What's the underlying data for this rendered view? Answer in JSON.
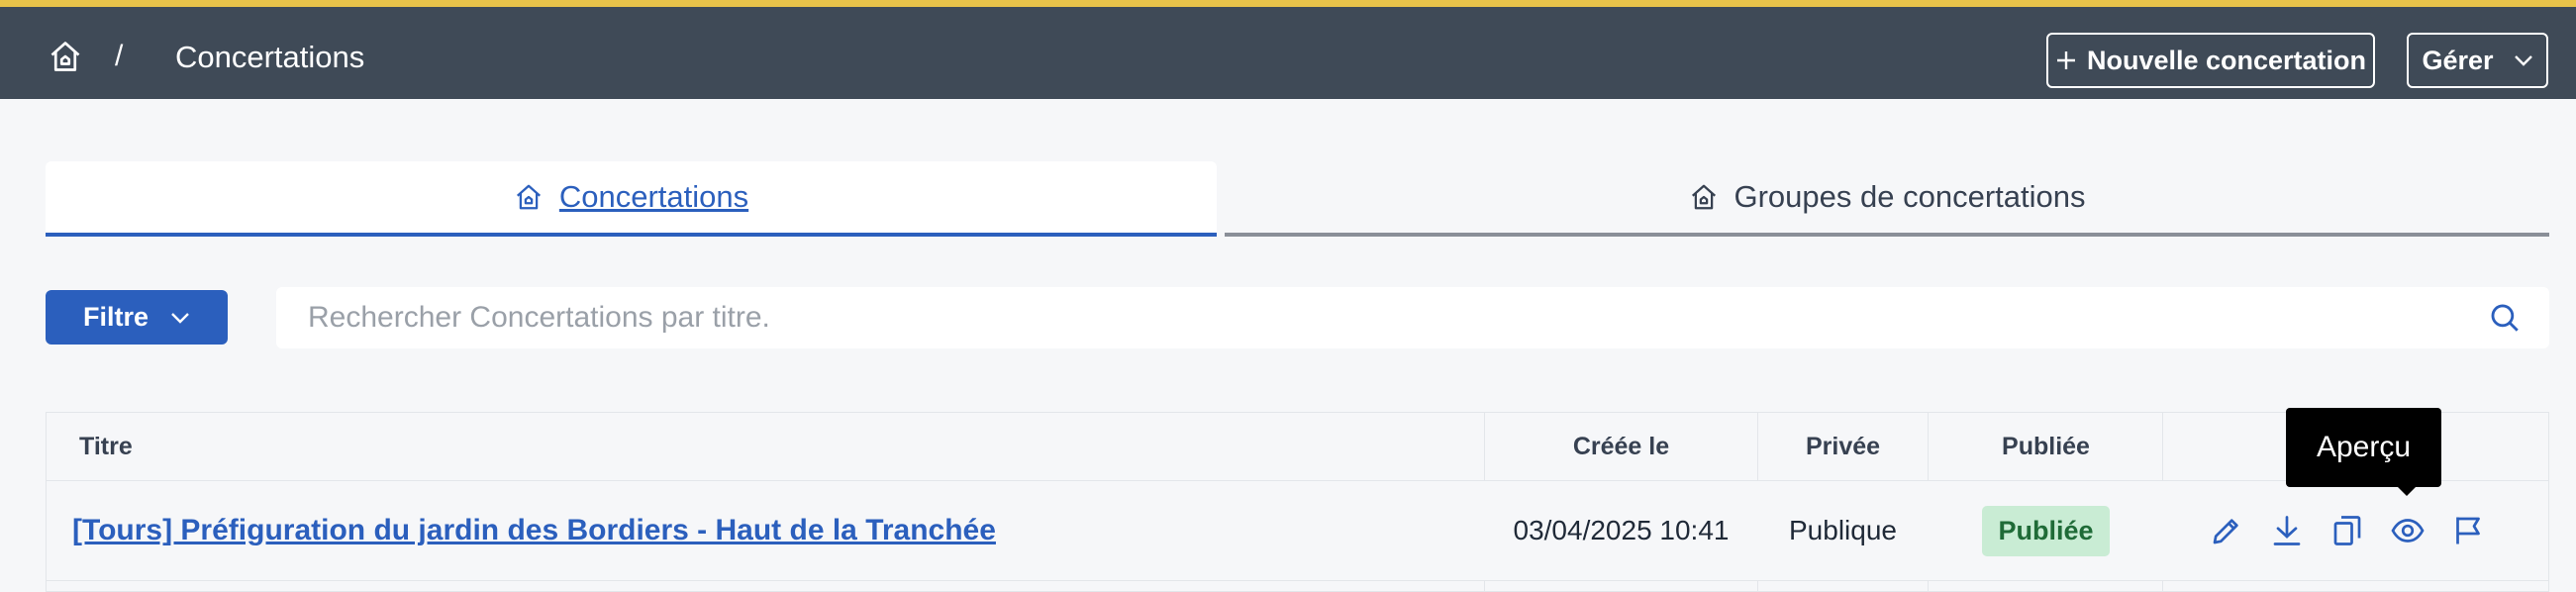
{
  "header": {
    "breadcrumb_separator": "/",
    "page_title": "Concertations",
    "new_button_label": "Nouvelle concertation",
    "manage_button_label": "Gérer",
    "accent_color": "#e8c34a",
    "bar_color": "#3f4a57"
  },
  "tabs": [
    {
      "label": "Concertations",
      "active": true
    },
    {
      "label": "Groupes de concertations",
      "active": false
    }
  ],
  "filter": {
    "label": "Filtre"
  },
  "search": {
    "placeholder": "Rechercher Concertations par titre."
  },
  "table": {
    "columns": [
      "Titre",
      "Créée le",
      "Privée",
      "Publiée"
    ],
    "rows": [
      {
        "title": "[Tours] Préfiguration du jardin des Bordiers - Haut de la Tranchée",
        "created": "03/04/2025 10:41",
        "privacy": "Publique",
        "status": "Publiée",
        "actions": [
          "edit-icon",
          "download-icon",
          "copy-icon",
          "eye-icon",
          "flag-icon"
        ]
      }
    ]
  },
  "tooltip": {
    "text": "Aperçu"
  },
  "colors": {
    "primary": "#2b5fbd",
    "badge_bg": "#c9ecd4",
    "badge_text": "#1f6b37"
  }
}
